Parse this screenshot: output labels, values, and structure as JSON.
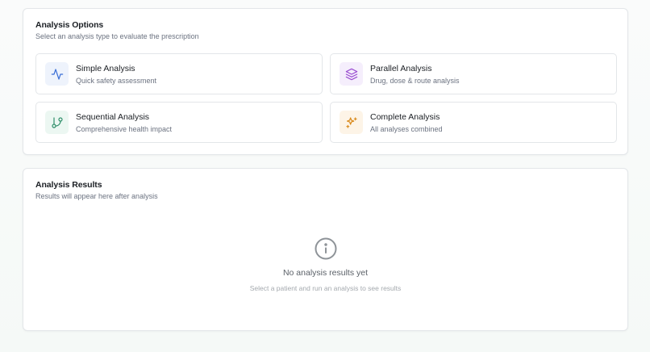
{
  "options_card": {
    "title": "Analysis Options",
    "subtitle": "Select an analysis type to evaluate the prescription",
    "options": [
      {
        "title": "Simple Analysis",
        "description": "Quick safety assessment",
        "icon": "activity-icon",
        "color": "#3b6fd6",
        "bg": "#eef3fc"
      },
      {
        "title": "Parallel Analysis",
        "description": "Drug, dose & route analysis",
        "icon": "layers-icon",
        "color": "#9b4fd1",
        "bg": "#f5eefc"
      },
      {
        "title": "Sequential Analysis",
        "description": "Comprehensive health impact",
        "icon": "git-branch-icon",
        "color": "#2f8f6a",
        "bg": "#ecf7f2"
      },
      {
        "title": "Complete Analysis",
        "description": "All analyses combined",
        "icon": "sparkles-icon",
        "color": "#d98a1c",
        "bg": "#fdf4e7"
      }
    ]
  },
  "results_card": {
    "title": "Analysis Results",
    "subtitle": "Results will appear here after analysis",
    "empty_icon": "info-icon",
    "empty_title": "No analysis results yet",
    "empty_description": "Select a patient and run an analysis to see results"
  }
}
